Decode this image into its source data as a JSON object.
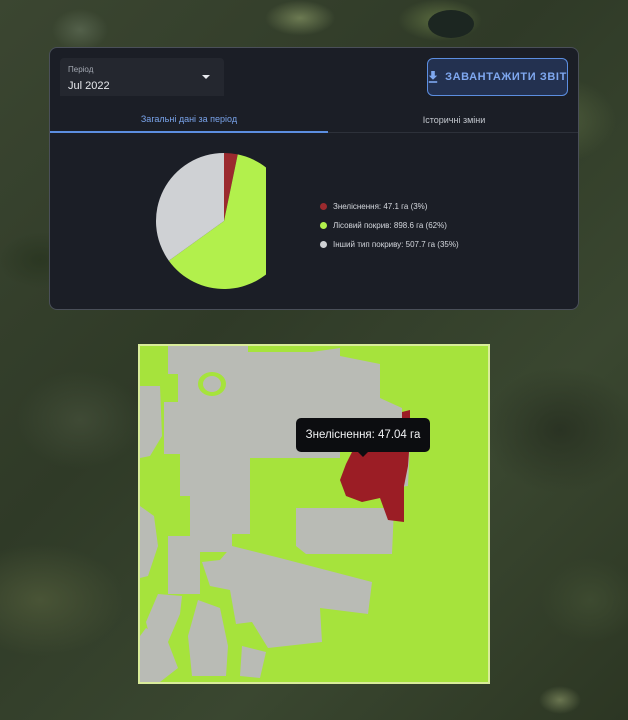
{
  "period": {
    "label": "Період",
    "value": "Jul 2022"
  },
  "download_button": {
    "label": "ЗАВАНТАЖИТИ ЗВІТ",
    "icon": "download-icon"
  },
  "tabs": [
    {
      "label": "Загальні дані за період",
      "active": true
    },
    {
      "label": "Історичні зміни",
      "active": false
    }
  ],
  "legend": [
    {
      "label": "Знеліснення: 47.1 га (3%)",
      "color": "#9b2a2e"
    },
    {
      "label": "Лісовий покрив: 898.6 га (62%)",
      "color": "#b2f04c"
    },
    {
      "label": "Інший тип покриву: 507.7 га (35%)",
      "color": "#cfd1d4"
    }
  ],
  "chart_data": {
    "type": "pie",
    "categories": [
      "Знеліснення",
      "Лісовий покрив",
      "Інший тип покриву"
    ],
    "values": [
      47.1,
      898.6,
      507.7
    ],
    "percent": [
      3,
      62,
      35
    ],
    "unit": "га",
    "colors": [
      "#9b2a2e",
      "#b2f04c",
      "#cfd1d4"
    ]
  },
  "map": {
    "tooltip": "Знеліснення: 47.04 га",
    "colors": {
      "forest": "#a6e33c",
      "other": "#b9bbb5",
      "deforestation": "#9b1d25"
    }
  }
}
